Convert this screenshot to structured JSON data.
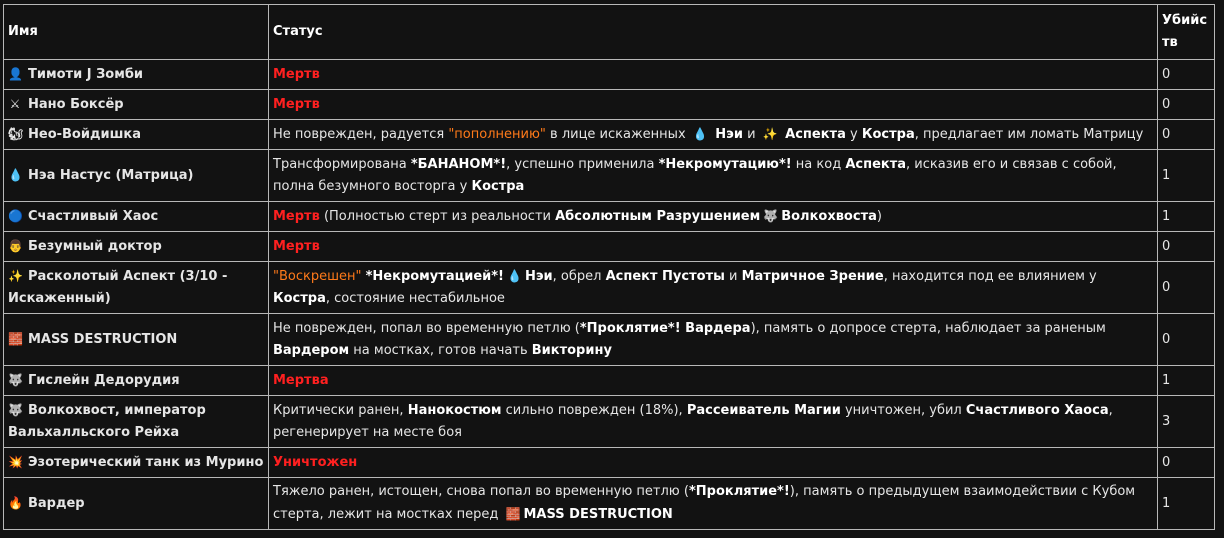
{
  "headers": {
    "name": "Имя",
    "status": "Статус",
    "kills": "Убийс тв"
  },
  "rows": [
    {
      "icon": "👤",
      "icon_name": "person-icon",
      "name": "Тимоти J Зомби",
      "kills": "0"
    },
    {
      "icon": "⚔",
      "icon_name": "crossed-swords-icon",
      "name": "Нано Боксёр",
      "kills": "0"
    },
    {
      "icon": "🐿",
      "icon_name": "squirrel-icon",
      "name": "Нео-Войдишка",
      "kills": "0"
    },
    {
      "icon": "💧",
      "icon_name": "blood-drop-icon",
      "name": "Нэа Настус (Матрица)",
      "kills": "1"
    },
    {
      "icon": "🔵",
      "icon_name": "blue-orb-icon",
      "name": "Счастливый Хаос",
      "kills": "1"
    },
    {
      "icon": "👨",
      "icon_name": "doctor-icon",
      "name": "Безумный доктор",
      "kills": "0"
    },
    {
      "icon": "✨",
      "icon_name": "sparkles-icon",
      "name": "Расколотый Аспект (3/10 - Искаженный)",
      "kills": "0"
    },
    {
      "icon": "🧱",
      "icon_name": "brick-icon",
      "name": "MASS DESTRUCTION",
      "kills": "0"
    },
    {
      "icon": "🐺",
      "icon_name": "wolf-icon",
      "name": "Гислейн Дедорудия",
      "kills": "1"
    },
    {
      "icon": "🐺",
      "icon_name": "wolf-icon",
      "name": "Волкохвост, император Вальхалльского Рейха",
      "kills": "3"
    },
    {
      "icon": "💥",
      "icon_name": "explosion-icon",
      "name": "Эзотерический танк из Мурино",
      "kills": "0"
    },
    {
      "icon": "🔥",
      "icon_name": "fire-icon",
      "name": "Вардер",
      "kills": "1"
    }
  ],
  "status": {
    "r0": "Мертв",
    "r1": "Мертв",
    "r2": {
      "t1": "Не поврежден, радуется ",
      "t2": "\"пополнению\"",
      "t3": " в лице искаженных ",
      "i1": "💧",
      "t4": " Нэи",
      "t5": " и ",
      "i2": "✨",
      "t6": " Аспекта",
      "t7": " у ",
      "t8": "Костра",
      "t9": ", предлагает им ломать Матрицу"
    },
    "r3": {
      "t1": "Трансформирована ",
      "t2": "*БАНАНОМ*!",
      "t3": ", успешно применила ",
      "t4": "*Некромутацию*!",
      "t5": " на код ",
      "t6": "Аспекта",
      "t7": ", исказив его и связав с собой, полна безумного восторга у ",
      "t8": "Костра"
    },
    "r4": {
      "t1": "Мертв",
      "t2": " (Полностью стерт из реальности ",
      "t3": "Абсолютным Разрушением",
      "i1": "🐺",
      "t4": "Волкохвоста",
      "t5": ")"
    },
    "r5": "Мертв",
    "r6": {
      "t1": "\"Воскрешен\"",
      "t2": "*Некромутацией*!",
      "i1": "💧",
      "t3": "Нэи",
      "t4": ", обрел ",
      "t5": "Аспект Пустоты",
      "t6": " и ",
      "t7": "Матричное Зрение",
      "t8": ", находится под ее влиянием у ",
      "t9": "Костра",
      "t10": ", состояние нестабильное"
    },
    "r7": {
      "t1": "Не поврежден, попал во временную петлю (",
      "t2": "*Проклятие*! Вардера",
      "t3": "), память о допросе стерта, наблюдает за раненым ",
      "t4": "Вардером",
      "t5": " на мостках, готов начать ",
      "t6": "Викторину"
    },
    "r8": "Мертва",
    "r9": {
      "t1": "Критически ранен, ",
      "t2": "Нанокостюм",
      "t3": " сильно поврежден (18%), ",
      "t4": "Рассеиватель Магии",
      "t5": " уничтожен, убил ",
      "t6": "Счастливого Хаоса",
      "t7": ", регенерирует на месте боя"
    },
    "r10": "Уничтожен",
    "r11": {
      "t1": "Тяжело ранен, истощен, снова попал во временную петлю (",
      "t2": "*Проклятие*!",
      "t3": "), память о предыдущем взаимодействии с Кубом стерта, лежит на мостках перед ",
      "i1": "🧱",
      "t4": "MASS DESTRUCTION"
    }
  }
}
